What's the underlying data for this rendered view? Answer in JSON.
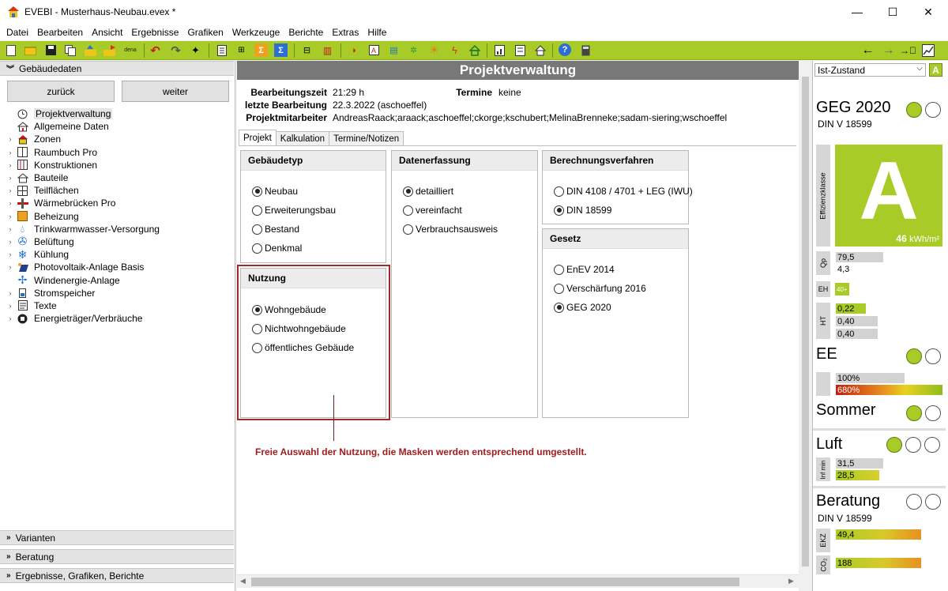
{
  "window": {
    "title": "EVEBI  - Musterhaus-Neubau.evex *",
    "minimize": "—",
    "maximize": "☐",
    "close": "✕"
  },
  "menu": [
    "Datei",
    "Bearbeiten",
    "Ansicht",
    "Ergebnisse",
    "Grafiken",
    "Werkzeuge",
    "Berichte",
    "Extras",
    "Hilfe"
  ],
  "toolbar": {
    "dena_label": "dena"
  },
  "left": {
    "header": "Gebäudedaten",
    "back_button": "zurück",
    "next_button": "weiter",
    "tree": [
      {
        "label": "Projektverwaltung",
        "icon": "clock-icon",
        "expandable": false,
        "selected": true
      },
      {
        "label": "Allgemeine Daten",
        "icon": "house-icon",
        "expandable": false
      },
      {
        "label": "Zonen",
        "icon": "zone-icon",
        "expandable": true
      },
      {
        "label": "Raumbuch Pro",
        "icon": "room-icon",
        "expandable": true
      },
      {
        "label": "Konstruktionen",
        "icon": "construction-icon",
        "expandable": true
      },
      {
        "label": "Bauteile",
        "icon": "component-icon",
        "expandable": true
      },
      {
        "label": "Teilflächen",
        "icon": "area-icon",
        "expandable": true
      },
      {
        "label": "Wärmebrücken Pro",
        "icon": "thermal-bridge-icon",
        "expandable": true
      },
      {
        "label": "Beheizung",
        "icon": "heating-icon",
        "expandable": true
      },
      {
        "label": "Trinkwarmwasser-Versorgung",
        "icon": "water-drop-icon",
        "expandable": true
      },
      {
        "label": "Belüftung",
        "icon": "fan-icon",
        "expandable": true
      },
      {
        "label": "Kühlung",
        "icon": "snowflake-icon",
        "expandable": true
      },
      {
        "label": "Photovoltaik-Anlage Basis",
        "icon": "solar-icon",
        "expandable": true
      },
      {
        "label": "Windenergie-Anlage",
        "icon": "wind-icon",
        "expandable": false
      },
      {
        "label": "Stromspeicher",
        "icon": "battery-icon",
        "expandable": true
      },
      {
        "label": "Texte",
        "icon": "text-icon",
        "expandable": true
      },
      {
        "label": "Energieträger/Verbräuche",
        "icon": "plug-icon",
        "expandable": true
      }
    ],
    "bottom_sections": [
      "Varianten",
      "Beratung",
      "Ergebnisse, Grafiken, Berichte"
    ]
  },
  "main": {
    "title": "Projektverwaltung",
    "info": {
      "edit_time_label": "Bearbeitungszeit",
      "edit_time": "21:29 h",
      "last_edit_label": "letzte Bearbeitung",
      "last_edit": "22.3.2022 (aschoeffel)",
      "staff_label": "Projektmitarbeiter",
      "staff": "AndreasRaack;araack;aschoeffel;ckorge;kschubert;MelinaBrenneke;sadam-siering;wschoeffel",
      "dates_label": "Termine",
      "dates": "keine"
    },
    "tabs": [
      "Projekt",
      "Kalkulation",
      "Termine/Notizen"
    ],
    "groups": {
      "gebaeudetyp": {
        "title": "Gebäudetyp",
        "options": [
          "Neubau",
          "Erweiterungsbau",
          "Bestand",
          "Denkmal"
        ],
        "selected": 0
      },
      "nutzung": {
        "title": "Nutzung",
        "options": [
          "Wohngebäude",
          "Nichtwohngebäude",
          "öffentliches Gebäude"
        ],
        "selected": 0
      },
      "datenerfassung": {
        "title": "Datenerfassung",
        "options": [
          "detailliert",
          "vereinfacht",
          "Verbrauchsausweis"
        ],
        "selected": 0
      },
      "berechnung": {
        "title": "Berechnungsverfahren",
        "options": [
          "DIN 4108 / 4701 + LEG (IWU)",
          "DIN 18599"
        ],
        "selected": 1
      },
      "gesetz": {
        "title": "Gesetz",
        "options": [
          "EnEV 2014",
          "Verschärfung 2016",
          "GEG 2020"
        ],
        "selected": 2
      }
    },
    "callout": "Freie Auswahl der Nutzung, die Masken werden entsprechend umgestellt."
  },
  "right": {
    "state_select": "Ist-Zustand",
    "badge": "A",
    "geg": {
      "title": "GEG 2020",
      "sub": "DIN V 18599"
    },
    "effizienz": {
      "label": "Effizienzklasse",
      "class": "A",
      "value": "46",
      "unit": "kWh/m²"
    },
    "qp": {
      "label": "Qp",
      "v1": "79,5",
      "v2": "4,3"
    },
    "eh": {
      "label": "EH",
      "value": "40+"
    },
    "ht": {
      "label": "HT",
      "v1": "0,22",
      "v2": "0,40",
      "v3": "0,40"
    },
    "ee": {
      "title": "EE",
      "v1": "100%",
      "v2": "680%"
    },
    "sommer": {
      "title": "Sommer"
    },
    "luft": {
      "title": "Luft",
      "label": "Inf min",
      "v1": "31,5",
      "v2": "28,5"
    },
    "beratung": {
      "title": "Beratung",
      "sub": "DIN V 18599",
      "ekz_label": "EKZ",
      "ekz": "49,4",
      "co2_label": "CO₂",
      "co2": "188"
    },
    "colors": {
      "accent": "#a8cb27",
      "title_gray": "#787878",
      "callout_red": "#a32a2a"
    }
  }
}
